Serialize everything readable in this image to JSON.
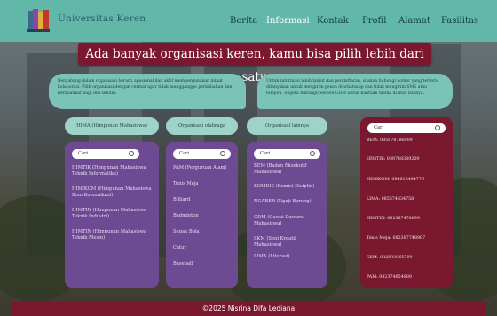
{
  "brand": "Universitas Keren",
  "nav": [
    "Berita",
    "Informasi",
    "Kontak",
    "Profil",
    "Alamat",
    "Fasilitas"
  ],
  "nav_active": "Informasi",
  "headline": "Ada banyak organisasi keren, kamu bisa pilih lebih dari satu",
  "info_left": "Bergabung dalam organisasi berarti apasional dan aktif mempergunakan minat kolaborasi. Pilih organisasi dengan cermat agar tidak mengganggu perkuliahan dan bermanfaat bagi diri sendiri.",
  "info_right": "Untuk informasi lebih lanjut dan pendaftaran, silakan hubungi nomor yang tertera, ditanyakan untuk mengirim pesan di whatsapp dan tidak mengirim SMS atau telepon. Segera hubungi/telepon GDM untuk bantuan media di atas lainnya.",
  "tabs": [
    "HIMA (Himpunan Mahasiswa)",
    "Organisasi olahraga",
    "Organisasi lainnya"
  ],
  "search_placeholder": "Cari",
  "col_hima": [
    "HIMTIK (Himpunan Mahasiswa Teknik Informatika)",
    "HIMIKOM (Himpunan Mahasiswa Ilmu Komunikasi)",
    "HIMTIN (Himpunan Mahasiswa Teknik Industri)",
    "HIMTIN (Himpunan Mahasiswa Teknik Mesin)"
  ],
  "col_sport": [
    "PAM (Perguruan Alam)",
    "Tenis Meja",
    "Billiard",
    "Badminton",
    "Sepak Bola",
    "Catur",
    "Baseball"
  ],
  "col_other": [
    "BEM (Badan Eksekutif Mahasiswa)",
    "KOMDIS (Komisi Disiplin)",
    "NGABER (Ngaji Bareng)",
    "GDM (Gawai Dawara Mahasiswa)",
    "SKM (Seni Kreatif Mahasiswa)",
    "LIMA (Literasi)"
  ],
  "contacts": [
    "BEM: 085678786909",
    "HIMTIK: 089748389209",
    "HIMIKOM: 084613484776",
    "LIMA: 085674834758",
    "HIMTIN: 082387478699",
    "Tenis Meja: 082387748987",
    "SKM: 082593965799",
    "PAM: 082374654989"
  ],
  "footer": "©2025 Nisrina Difa Lediana",
  "colors": {
    "navbar": "#62b8a8",
    "maroon": "#7a1830",
    "purple": "#6e4a93",
    "teal_box": "#7bc3b6"
  }
}
